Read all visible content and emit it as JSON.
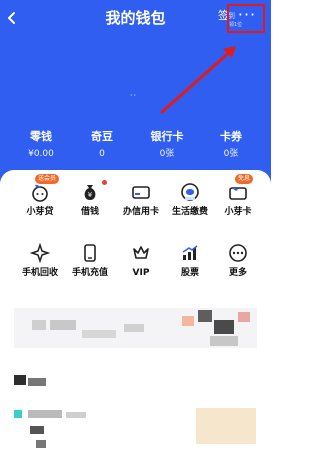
{
  "header": {
    "title": "我的钱包",
    "checkin_big": "签",
    "checkin_small": "到",
    "checkin_sub": "领1位",
    "more_symbol": "···",
    "accent": "#2f5ef1"
  },
  "stats": [
    {
      "label": "零钱",
      "value": "¥0.00"
    },
    {
      "label": "奇豆",
      "value": "0"
    },
    {
      "label": "银行卡",
      "value": "0张"
    },
    {
      "label": "卡券",
      "value": "0张"
    }
  ],
  "services_row1": [
    {
      "label": "小芽贷",
      "icon": "sprout-loan-icon",
      "badge": "送会员"
    },
    {
      "label": "借钱",
      "icon": "money-bag-icon",
      "red_dot": true
    },
    {
      "label": "办信用卡",
      "icon": "credit-card-icon"
    },
    {
      "label": "生活缴费",
      "icon": "life-payment-icon"
    },
    {
      "label": "小芽卡",
      "icon": "sprout-card-icon",
      "badge": "免息"
    }
  ],
  "services_row2": [
    {
      "label": "手机回收",
      "icon": "phone-recycle-icon"
    },
    {
      "label": "手机充值",
      "icon": "phone-topup-icon"
    },
    {
      "label": "VIP",
      "icon": "vip-crown-icon"
    },
    {
      "label": "股票",
      "icon": "stock-chart-icon"
    },
    {
      "label": "更多",
      "icon": "more-dots-icon"
    }
  ]
}
